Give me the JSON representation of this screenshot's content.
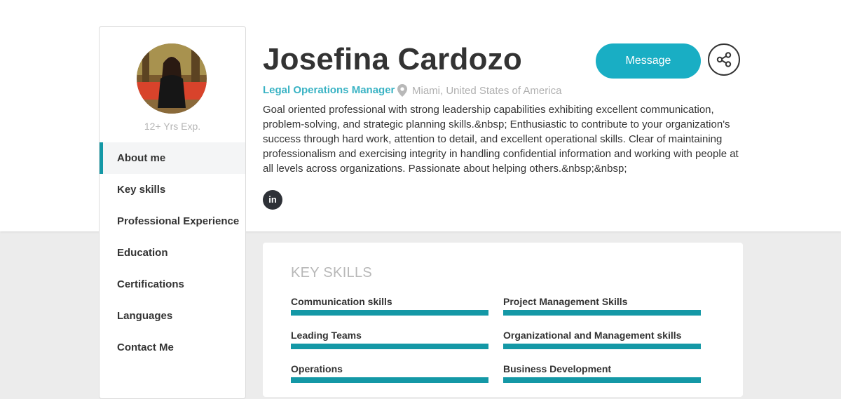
{
  "profile": {
    "name": "Josefina Cardozo",
    "role": "Legal Operations Manager",
    "location": "Miami, United States of America",
    "experience": "12+ Yrs Exp.",
    "summary": "Goal oriented professional with strong leadership capabilities exhibiting excellent communication, problem-solving, and strategic planning skills.&nbsp; Enthusiastic to contribute to your organization's success through hard work, attention to detail, and excellent operational skills. Clear of maintaining professionalism and exercising integrity in handling confidential information and working with people at all levels across organizations. Passionate about helping others.&nbsp;&nbsp;",
    "social_label": "in"
  },
  "actions": {
    "message_label": "Message",
    "share_icon": "share-icon"
  },
  "sidebar": {
    "items": [
      {
        "label": "About me",
        "active": true
      },
      {
        "label": "Key skills",
        "active": false
      },
      {
        "label": "Professional Experience",
        "active": false
      },
      {
        "label": "Education",
        "active": false
      },
      {
        "label": "Certifications",
        "active": false
      },
      {
        "label": "Languages",
        "active": false
      },
      {
        "label": "Contact Me",
        "active": false
      }
    ]
  },
  "key_skills": {
    "title": "KEY SKILLS",
    "items": [
      {
        "label": "Communication skills",
        "level": 1.0
      },
      {
        "label": "Project Management Skills",
        "level": 1.0
      },
      {
        "label": "Leading Teams",
        "level": 1.0
      },
      {
        "label": "Organizational and Management skills",
        "level": 1.0
      },
      {
        "label": "Operations",
        "level": 1.0
      },
      {
        "label": "Business Development",
        "level": 1.0
      }
    ]
  },
  "colors": {
    "accent": "#1498a6",
    "button": "#19aec4",
    "role": "#3ab3c4"
  }
}
